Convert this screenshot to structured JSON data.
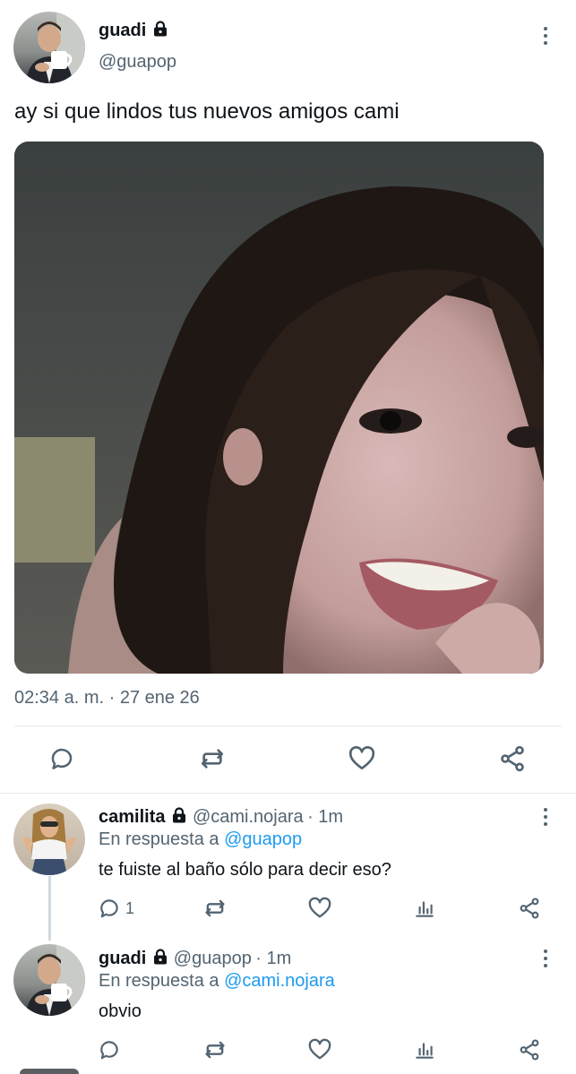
{
  "main_tweet": {
    "author_name": "guadi",
    "author_handle": "@guapop",
    "text": "ay si que lindos tus nuevos amigos cami",
    "timestamp": "02:34 a. m. · 27 ene 26"
  },
  "actions": {
    "reply": "reply-icon",
    "retweet": "retweet-icon",
    "like": "heart-icon",
    "share": "share-icon"
  },
  "replies": [
    {
      "author_name": "camilita",
      "author_handle": "@cami.nojara",
      "time": "· 1m",
      "reply_prefix": "En respuesta a",
      "reply_to": "@guapop",
      "text": "te fuiste al baño sólo para decir eso?",
      "reply_count": "1"
    },
    {
      "author_name": "guadi",
      "author_handle": "@guapop",
      "time": "· 1m",
      "reply_prefix": "En respuesta a",
      "reply_to": "@cami.nojara",
      "text": "obvio"
    }
  ],
  "colors": {
    "text": "#0f1419",
    "secondary": "#536471",
    "link": "#1d9bf0",
    "divider": "#e6ecf0"
  }
}
